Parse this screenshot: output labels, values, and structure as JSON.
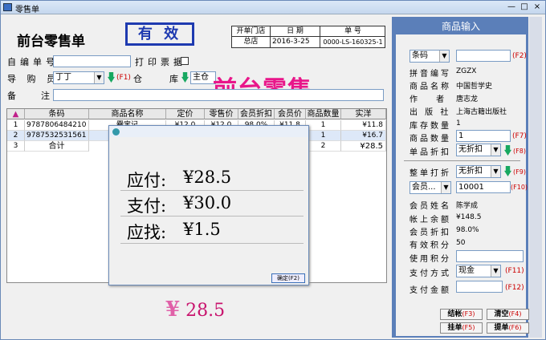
{
  "window": {
    "title": "零售单",
    "min": "—",
    "max": "□",
    "close": "×"
  },
  "form": {
    "title": "前台零售单",
    "valid_stamp": "有 效",
    "big_banner": "前台零售",
    "info_headers": [
      "开单门店",
      "日 期",
      "单 号"
    ],
    "store": "总店",
    "date": "2016-3-25",
    "order_no": "0000-LS-160325-1",
    "self_no_label": "自编单号",
    "print_label": "打印票据",
    "guide_label": "导 购 员",
    "guide_value": "丁丁",
    "guide_fkey": "(F1)",
    "warehouse_label": "仓",
    "warehouse_label2": "库",
    "warehouse_value": "主仓",
    "note_label": "备",
    "note_label2": "注"
  },
  "table": {
    "headers": [
      "",
      "条码",
      "商品名称",
      "定价",
      "零售价",
      "会员折扣",
      "会员价",
      "商品数量",
      "实洋"
    ],
    "rows": [
      [
        "1",
        "9787806484210",
        "爨宝记",
        "¥12.0",
        "¥12.0",
        "98.0%",
        "¥11.8",
        "1",
        "¥11.8"
      ],
      [
        "2",
        "9787532531561",
        "",
        "",
        "",
        "",
        "",
        "1",
        "¥16.7"
      ],
      [
        "3",
        "合计",
        "",
        "",
        "",
        "",
        "",
        "2",
        "¥28.5"
      ]
    ]
  },
  "dialog": {
    "payable_label": "应付:",
    "payable_value": "¥28.5",
    "paid_label": "支付:",
    "paid_value": "¥30.0",
    "change_label": "应找:",
    "change_value": "¥1.5",
    "ok_button": "确定(F2)"
  },
  "total_display": {
    "symbol": "¥",
    "value": "28.5"
  },
  "right_panel": {
    "title": "商品输入",
    "code_select": "条码",
    "code_fkey": "(F2)",
    "fields": [
      {
        "label": "拼音编写",
        "value": "ZGZX"
      },
      {
        "label": "商品名称",
        "value": "中国哲学史"
      },
      {
        "label": "作 者",
        "value": "唐志龙"
      },
      {
        "label": "出 版 社",
        "value": "上海古籍出版社"
      },
      {
        "label": "库存数量",
        "value": "1"
      }
    ],
    "qty_label": "商品数量",
    "qty_value": "1",
    "qty_fkey": "(F7)",
    "item_discount_label": "单品折扣",
    "item_discount_value": "无折扣",
    "item_discount_fkey": "(F8)",
    "order_discount_label": "整单打折",
    "order_discount_value": "无折扣",
    "order_discount_fkey": "(F9)",
    "member_select": "会员...",
    "member_no": "10001",
    "member_fkey": "(F10)",
    "member_info": [
      {
        "label": "会员姓名",
        "value": "陈学成"
      },
      {
        "label": "帐上余额",
        "value": "¥148.5"
      },
      {
        "label": "会员折扣",
        "value": "98.0%"
      },
      {
        "label": "有效积分",
        "value": "50"
      }
    ],
    "use_points_label": "使用积分",
    "pay_method_label": "支付方式",
    "pay_method_value": "现金",
    "pay_method_fkey": "(F11)",
    "pay_amount_label": "支付金额",
    "pay_amount_fkey": "(F12)",
    "buttons": [
      {
        "label": "结帐",
        "key": "(F3)"
      },
      {
        "label": "清空",
        "key": "(F4)"
      },
      {
        "label": "挂单",
        "key": "(F5)"
      },
      {
        "label": "提单",
        "key": "(F6)"
      }
    ]
  }
}
